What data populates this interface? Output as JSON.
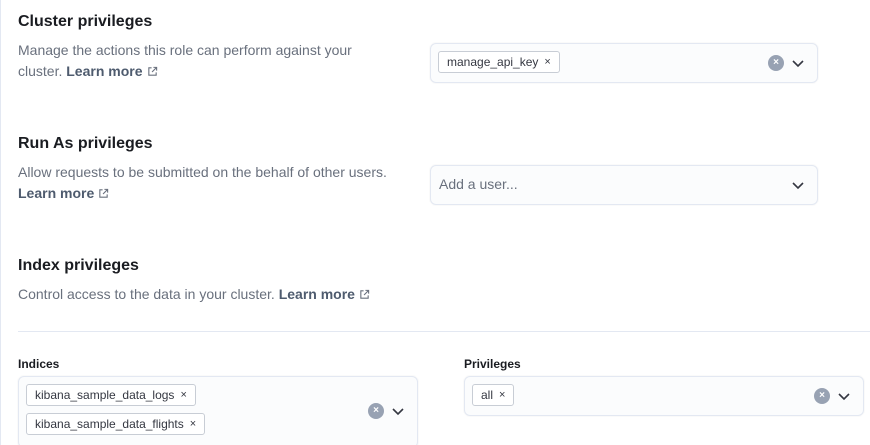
{
  "cluster": {
    "title": "Cluster privileges",
    "desc": "Manage the actions this role can perform against your cluster.",
    "learn_more": "Learn more",
    "chips": [
      "manage_api_key"
    ]
  },
  "run_as": {
    "title": "Run As privileges",
    "desc": "Allow requests to be submitted on the behalf of other users.",
    "learn_more": "Learn more",
    "placeholder": "Add a user..."
  },
  "index": {
    "title": "Index privileges",
    "desc": "Control access to the data in your cluster.",
    "learn_more": "Learn more",
    "indices_label": "Indices",
    "indices_chips": [
      "kibana_sample_data_logs",
      "kibana_sample_data_flights"
    ],
    "privileges_label": "Privileges",
    "privileges_chips": [
      "all"
    ]
  },
  "icons": {
    "remove": "×",
    "clear": "×"
  },
  "colors": {
    "link": "#4e5b6e",
    "title": "#1a1c21",
    "muted": "#69707d",
    "border": "#e3e8f2",
    "clear": "#98a2b3"
  }
}
